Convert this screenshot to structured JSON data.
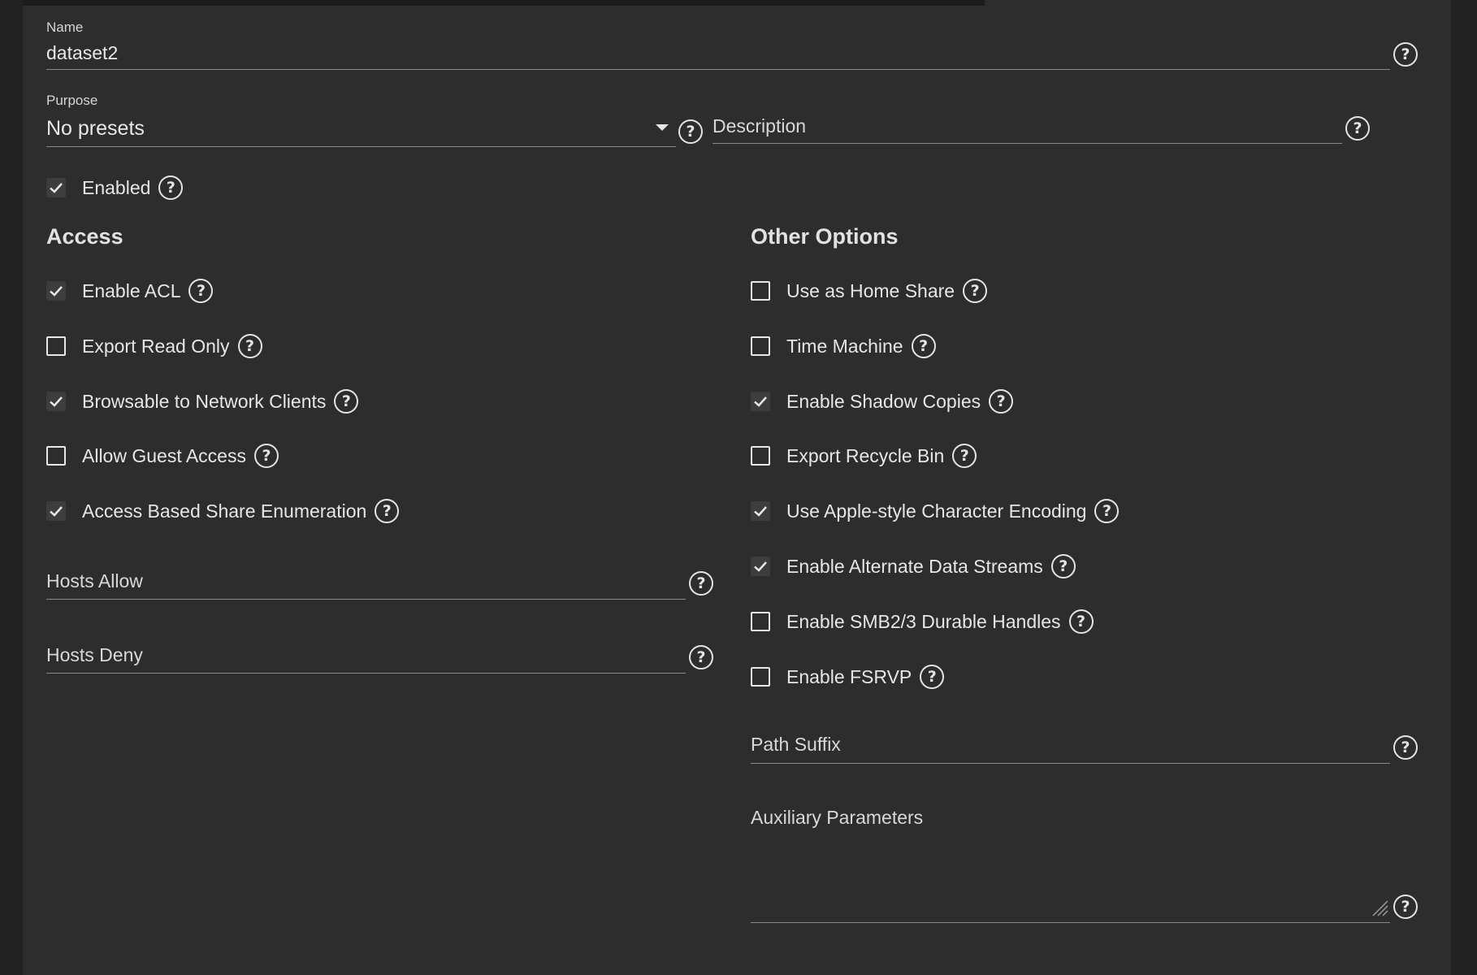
{
  "name": {
    "label": "Name",
    "value": "dataset2"
  },
  "purpose": {
    "label": "Purpose",
    "value": "No presets"
  },
  "description": {
    "placeholder": "Description",
    "value": ""
  },
  "enabled": {
    "label": "Enabled",
    "checked": true
  },
  "access": {
    "title": "Access",
    "options": [
      {
        "label": "Enable ACL",
        "checked": true
      },
      {
        "label": "Export Read Only",
        "checked": false
      },
      {
        "label": "Browsable to Network Clients",
        "checked": true
      },
      {
        "label": "Allow Guest Access",
        "checked": false
      },
      {
        "label": "Access Based Share Enumeration",
        "checked": true
      }
    ],
    "hosts_allow": {
      "placeholder": "Hosts Allow",
      "value": ""
    },
    "hosts_deny": {
      "placeholder": "Hosts Deny",
      "value": ""
    }
  },
  "other": {
    "title": "Other Options",
    "options": [
      {
        "label": "Use as Home Share",
        "checked": false
      },
      {
        "label": "Time Machine",
        "checked": false
      },
      {
        "label": "Enable Shadow Copies",
        "checked": true
      },
      {
        "label": "Export Recycle Bin",
        "checked": false
      },
      {
        "label": "Use Apple-style Character Encoding",
        "checked": true
      },
      {
        "label": "Enable Alternate Data Streams",
        "checked": true
      },
      {
        "label": "Enable SMB2/3 Durable Handles",
        "checked": false
      },
      {
        "label": "Enable FSRVP",
        "checked": false
      }
    ],
    "path_suffix": {
      "placeholder": "Path Suffix",
      "value": ""
    },
    "auxiliary": {
      "placeholder": "Auxiliary Parameters",
      "value": ""
    }
  },
  "icons": {
    "help": "help-circle-icon",
    "check": "check-icon",
    "dropdown": "caret-down-icon"
  },
  "colors": {
    "background": "#2d2d2d",
    "text": "#e8e8e8",
    "checked_box": "#3d3d3d"
  }
}
